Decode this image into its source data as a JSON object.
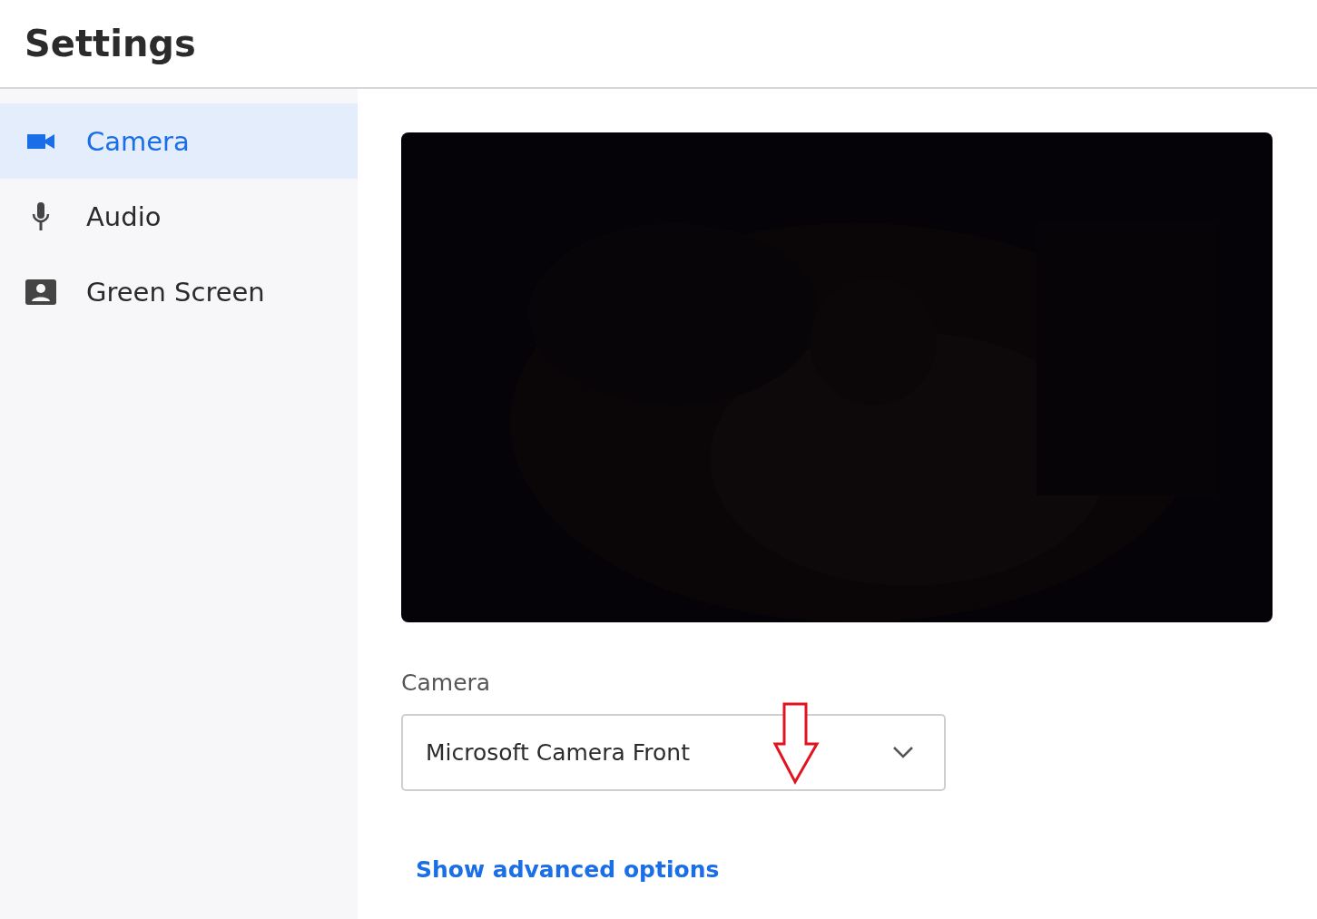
{
  "window": {
    "title": "Settings"
  },
  "sidebar": {
    "items": [
      {
        "label": "Camera",
        "selected": true,
        "kind": "camera"
      },
      {
        "label": "Audio",
        "selected": false,
        "kind": "microphone"
      },
      {
        "label": "Green Screen",
        "selected": false,
        "kind": "portrait"
      }
    ]
  },
  "camera_select": {
    "label": "Camera",
    "value": "Microsoft Camera Front"
  },
  "advanced_link": {
    "text": "Show advanced options"
  }
}
